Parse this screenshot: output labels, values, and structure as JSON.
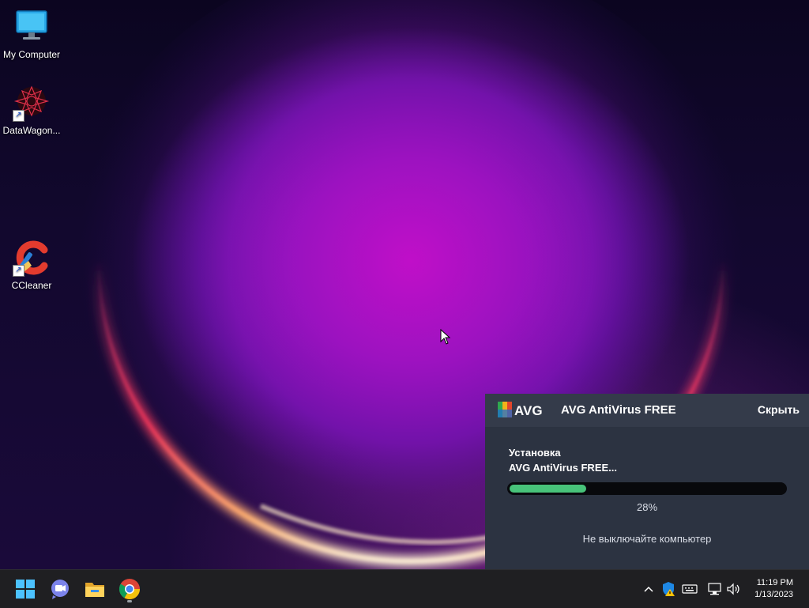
{
  "desktop": {
    "icons": [
      {
        "label": "My Computer",
        "icon": "monitor-icon"
      },
      {
        "label": "DataWagon...",
        "icon": "datawagon-app-icon"
      },
      {
        "label": "CCleaner",
        "icon": "ccleaner-icon"
      }
    ]
  },
  "avg": {
    "logo_text": "AVG",
    "title": "AVG AntiVirus FREE",
    "hide_label": "Скрыть",
    "step_label": "Установка",
    "product_label": "AVG AntiVirus FREE...",
    "progress": 0.28,
    "progress_text": "28%",
    "warning": "Не выключайте компьютер",
    "accent_color": "#48c37a"
  },
  "taskbar": {
    "pinned": [
      {
        "name": "start-button",
        "icon": "windows-start-icon"
      },
      {
        "name": "teams-chat-button",
        "icon": "teams-chat-icon"
      },
      {
        "name": "file-explorer-button",
        "icon": "folder-icon"
      },
      {
        "name": "chrome-button",
        "icon": "chrome-icon"
      }
    ],
    "tray_icons": [
      "chevron-up-icon",
      "security-warning-icon",
      "keyboard-icon",
      "network-icon",
      "volume-icon"
    ],
    "clock": {
      "time": "11:19 PM",
      "date": "1/13/2023"
    }
  }
}
